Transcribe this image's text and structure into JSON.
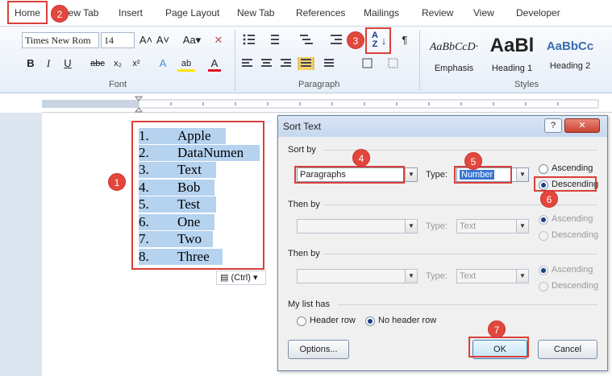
{
  "tabs": [
    "Home",
    "New Tab",
    "Insert",
    "Page Layout",
    "New Tab",
    "References",
    "Mailings",
    "Review",
    "View",
    "Developer"
  ],
  "ribbon": {
    "font_name": "Times New Rom",
    "font_size": "14",
    "font_group": "Font",
    "paragraph_group": "Paragraph",
    "styles_group": "Styles",
    "styles": [
      {
        "preview": "AaBbCcD·",
        "name": "Emphasis"
      },
      {
        "preview": "AaBl",
        "name": "Heading 1"
      },
      {
        "preview": "AaBbCc",
        "name": "Heading 2"
      }
    ],
    "buttons": {
      "grow": "A˄",
      "shrink": "A˅",
      "aa": "Aa▾",
      "clear": "✕",
      "bold": "B",
      "italic": "I",
      "underline": "U",
      "strike": "abc",
      "sub": "x₂",
      "sup": "x²",
      "effects": "A",
      "highlight": "ab",
      "color": "A",
      "pilcrow": "¶",
      "sort": "A↓"
    }
  },
  "document": {
    "list": [
      {
        "n": "1.",
        "t": "Apple"
      },
      {
        "n": "2.",
        "t": "DataNumen"
      },
      {
        "n": "3.",
        "t": "Text"
      },
      {
        "n": "4.",
        "t": "Bob"
      },
      {
        "n": "5.",
        "t": "Test"
      },
      {
        "n": "6.",
        "t": "One"
      },
      {
        "n": "7.",
        "t": "Two"
      },
      {
        "n": "8.",
        "t": "Three"
      }
    ],
    "paste_label": "(Ctrl)"
  },
  "dialog": {
    "title": "Sort Text",
    "help": "?",
    "close": "✕",
    "sort_by_label": "Sort by",
    "sort_by_value": "Paragraphs",
    "type_label": "Type:",
    "sort_type_value": "Number",
    "ascending": "Ascending",
    "descending": "Descending",
    "then_by1_label": "Then by",
    "then_by1_type": "Text",
    "then_by2_label": "Then by",
    "then_by2_type": "Text",
    "list_has_label": "My list has",
    "header_row": "Header row",
    "no_header_row": "No header row",
    "options": "Options...",
    "ok": "OK",
    "cancel": "Cancel"
  },
  "badges": [
    "1",
    "2",
    "3",
    "4",
    "5",
    "6",
    "7"
  ]
}
